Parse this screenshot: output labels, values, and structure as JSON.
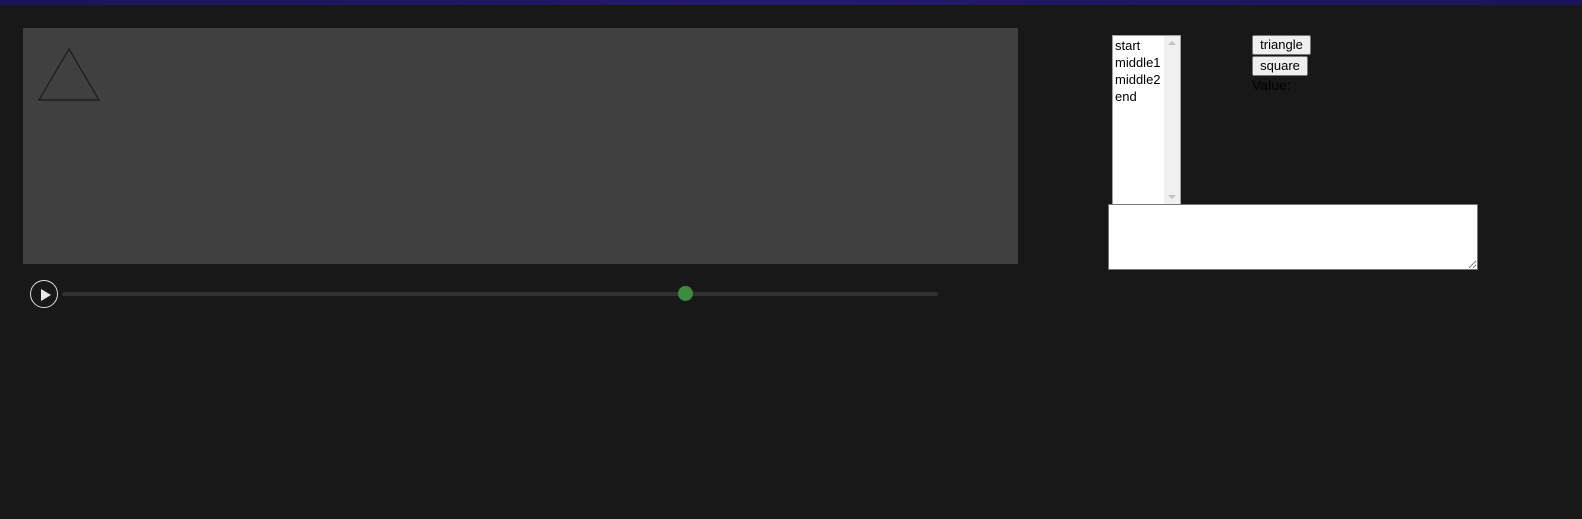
{
  "stage": {
    "background": "#404040",
    "shape": "triangle",
    "shape_stroke": "#1a1a1a"
  },
  "player": {
    "play_icon": "play-icon",
    "progress": 0.711,
    "thumb_color": "#3d8a40"
  },
  "keyframes": {
    "items": [
      {
        "label": "start"
      },
      {
        "label": "middle1"
      },
      {
        "label": "middle2"
      },
      {
        "label": "end"
      }
    ]
  },
  "buttons": {
    "triangle_label": "triangle",
    "square_label": "square"
  },
  "value": {
    "label": "Value:",
    "text": ""
  }
}
